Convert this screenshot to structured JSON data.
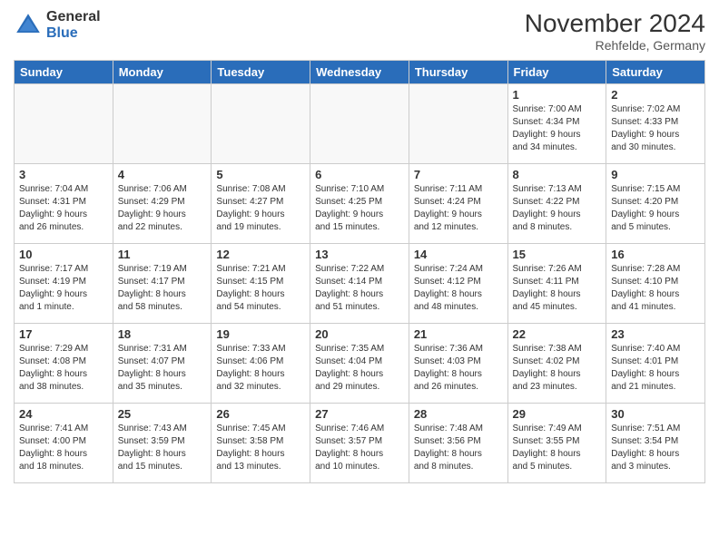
{
  "logo": {
    "general": "General",
    "blue": "Blue"
  },
  "title": "November 2024",
  "location": "Rehfelde, Germany",
  "days_of_week": [
    "Sunday",
    "Monday",
    "Tuesday",
    "Wednesday",
    "Thursday",
    "Friday",
    "Saturday"
  ],
  "weeks": [
    [
      {
        "day": "",
        "info": ""
      },
      {
        "day": "",
        "info": ""
      },
      {
        "day": "",
        "info": ""
      },
      {
        "day": "",
        "info": ""
      },
      {
        "day": "",
        "info": ""
      },
      {
        "day": "1",
        "info": "Sunrise: 7:00 AM\nSunset: 4:34 PM\nDaylight: 9 hours\nand 34 minutes."
      },
      {
        "day": "2",
        "info": "Sunrise: 7:02 AM\nSunset: 4:33 PM\nDaylight: 9 hours\nand 30 minutes."
      }
    ],
    [
      {
        "day": "3",
        "info": "Sunrise: 7:04 AM\nSunset: 4:31 PM\nDaylight: 9 hours\nand 26 minutes."
      },
      {
        "day": "4",
        "info": "Sunrise: 7:06 AM\nSunset: 4:29 PM\nDaylight: 9 hours\nand 22 minutes."
      },
      {
        "day": "5",
        "info": "Sunrise: 7:08 AM\nSunset: 4:27 PM\nDaylight: 9 hours\nand 19 minutes."
      },
      {
        "day": "6",
        "info": "Sunrise: 7:10 AM\nSunset: 4:25 PM\nDaylight: 9 hours\nand 15 minutes."
      },
      {
        "day": "7",
        "info": "Sunrise: 7:11 AM\nSunset: 4:24 PM\nDaylight: 9 hours\nand 12 minutes."
      },
      {
        "day": "8",
        "info": "Sunrise: 7:13 AM\nSunset: 4:22 PM\nDaylight: 9 hours\nand 8 minutes."
      },
      {
        "day": "9",
        "info": "Sunrise: 7:15 AM\nSunset: 4:20 PM\nDaylight: 9 hours\nand 5 minutes."
      }
    ],
    [
      {
        "day": "10",
        "info": "Sunrise: 7:17 AM\nSunset: 4:19 PM\nDaylight: 9 hours\nand 1 minute."
      },
      {
        "day": "11",
        "info": "Sunrise: 7:19 AM\nSunset: 4:17 PM\nDaylight: 8 hours\nand 58 minutes."
      },
      {
        "day": "12",
        "info": "Sunrise: 7:21 AM\nSunset: 4:15 PM\nDaylight: 8 hours\nand 54 minutes."
      },
      {
        "day": "13",
        "info": "Sunrise: 7:22 AM\nSunset: 4:14 PM\nDaylight: 8 hours\nand 51 minutes."
      },
      {
        "day": "14",
        "info": "Sunrise: 7:24 AM\nSunset: 4:12 PM\nDaylight: 8 hours\nand 48 minutes."
      },
      {
        "day": "15",
        "info": "Sunrise: 7:26 AM\nSunset: 4:11 PM\nDaylight: 8 hours\nand 45 minutes."
      },
      {
        "day": "16",
        "info": "Sunrise: 7:28 AM\nSunset: 4:10 PM\nDaylight: 8 hours\nand 41 minutes."
      }
    ],
    [
      {
        "day": "17",
        "info": "Sunrise: 7:29 AM\nSunset: 4:08 PM\nDaylight: 8 hours\nand 38 minutes."
      },
      {
        "day": "18",
        "info": "Sunrise: 7:31 AM\nSunset: 4:07 PM\nDaylight: 8 hours\nand 35 minutes."
      },
      {
        "day": "19",
        "info": "Sunrise: 7:33 AM\nSunset: 4:06 PM\nDaylight: 8 hours\nand 32 minutes."
      },
      {
        "day": "20",
        "info": "Sunrise: 7:35 AM\nSunset: 4:04 PM\nDaylight: 8 hours\nand 29 minutes."
      },
      {
        "day": "21",
        "info": "Sunrise: 7:36 AM\nSunset: 4:03 PM\nDaylight: 8 hours\nand 26 minutes."
      },
      {
        "day": "22",
        "info": "Sunrise: 7:38 AM\nSunset: 4:02 PM\nDaylight: 8 hours\nand 23 minutes."
      },
      {
        "day": "23",
        "info": "Sunrise: 7:40 AM\nSunset: 4:01 PM\nDaylight: 8 hours\nand 21 minutes."
      }
    ],
    [
      {
        "day": "24",
        "info": "Sunrise: 7:41 AM\nSunset: 4:00 PM\nDaylight: 8 hours\nand 18 minutes."
      },
      {
        "day": "25",
        "info": "Sunrise: 7:43 AM\nSunset: 3:59 PM\nDaylight: 8 hours\nand 15 minutes."
      },
      {
        "day": "26",
        "info": "Sunrise: 7:45 AM\nSunset: 3:58 PM\nDaylight: 8 hours\nand 13 minutes."
      },
      {
        "day": "27",
        "info": "Sunrise: 7:46 AM\nSunset: 3:57 PM\nDaylight: 8 hours\nand 10 minutes."
      },
      {
        "day": "28",
        "info": "Sunrise: 7:48 AM\nSunset: 3:56 PM\nDaylight: 8 hours\nand 8 minutes."
      },
      {
        "day": "29",
        "info": "Sunrise: 7:49 AM\nSunset: 3:55 PM\nDaylight: 8 hours\nand 5 minutes."
      },
      {
        "day": "30",
        "info": "Sunrise: 7:51 AM\nSunset: 3:54 PM\nDaylight: 8 hours\nand 3 minutes."
      }
    ]
  ]
}
